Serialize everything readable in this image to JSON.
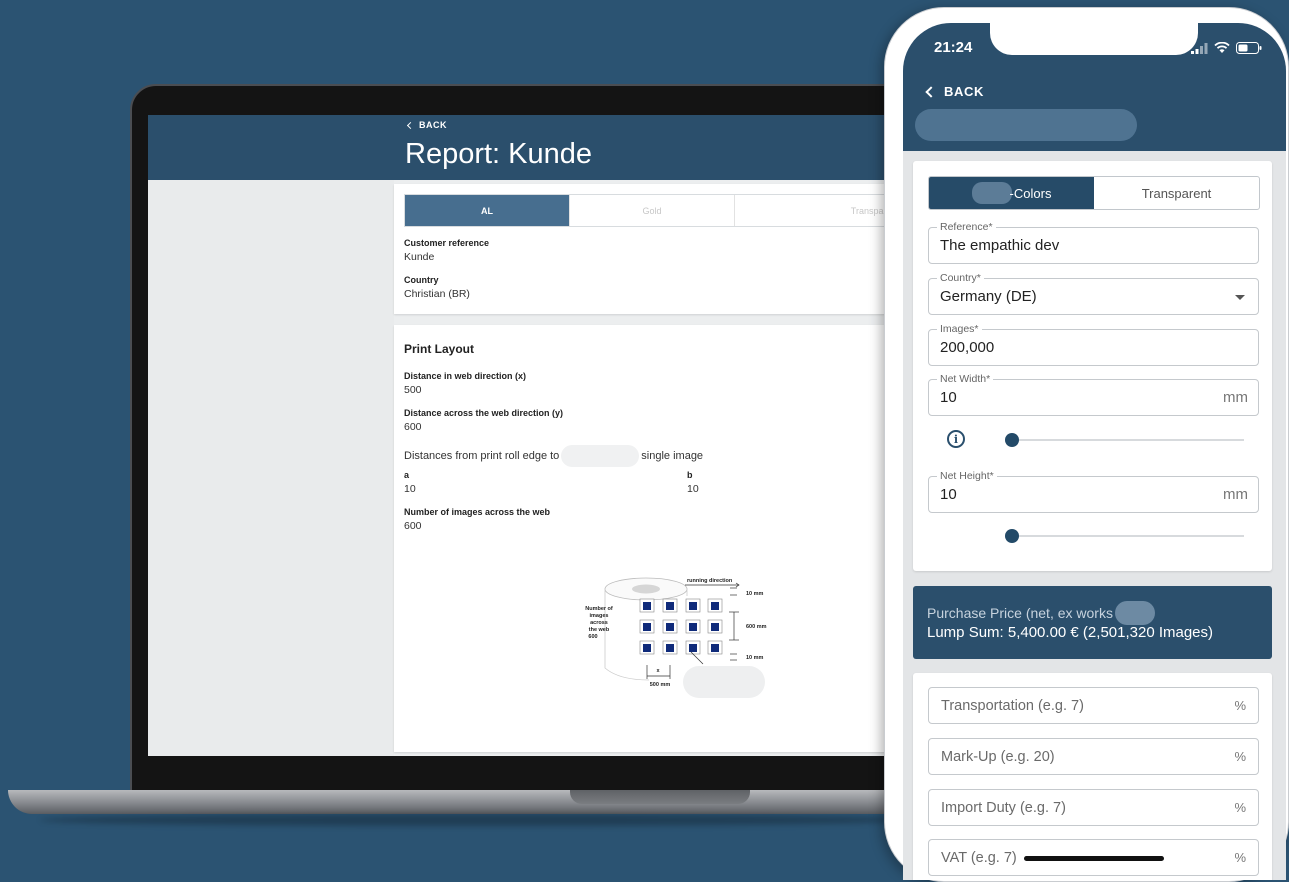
{
  "laptop": {
    "back_label": "BACK",
    "title": "Report: Kunde",
    "tabs": [
      {
        "label": "AL",
        "active": true
      },
      {
        "label": "Gold",
        "active": false
      },
      {
        "label": "Transparent",
        "active": false
      }
    ],
    "customer_reference": {
      "label": "Customer reference",
      "value": "Kunde"
    },
    "country": {
      "label": "Country",
      "value": "Christian (BR)"
    },
    "print_layout": {
      "heading": "Print Layout",
      "distance_x": {
        "label": "Distance in web direction (x)",
        "value": "500"
      },
      "distance_y": {
        "label": "Distance across the web direction (y)",
        "value": "600"
      },
      "distances_text_start": "Distances from print roll edge to",
      "distances_text_end": "single image",
      "a": {
        "label": "a",
        "value": "10"
      },
      "b": {
        "label": "b",
        "value": "10"
      },
      "images_across": {
        "label": "Number of images across the web",
        "value": "600"
      }
    },
    "diagram": {
      "running_direction": "running direction",
      "number_label": [
        "Number of",
        "images",
        "across",
        "the web",
        "600"
      ],
      "dim_top": "10 mm",
      "dim_mid": "600 mm",
      "dim_bottom": "10 mm",
      "x_label": "x",
      "x_value": "500 mm"
    }
  },
  "phone": {
    "time": "21:24",
    "back_label": "BACK",
    "segments": [
      {
        "label": "-Colors",
        "active": true
      },
      {
        "label": "Transparent",
        "active": false
      }
    ],
    "fields": {
      "reference": {
        "label": "Reference*",
        "value": "The empathic dev"
      },
      "country": {
        "label": "Country*",
        "value": "Germany (DE)"
      },
      "images": {
        "label": "Images*",
        "value": "200,000"
      },
      "net_width": {
        "label": "Net Width*",
        "value": "10",
        "unit": "mm"
      },
      "net_height": {
        "label": "Net Height*",
        "value": "10",
        "unit": "mm"
      }
    },
    "purchase_price": {
      "line1": "Purchase Price (net, ex works",
      "line2": "Lump Sum:  5,400.00 €  (2,501,320 Images)"
    },
    "percent_fields": [
      {
        "placeholder": "Transportation (e.g. 7)",
        "unit": "%"
      },
      {
        "placeholder": "Mark-Up (e.g. 20)",
        "unit": "%"
      },
      {
        "placeholder": "Import Duty (e.g. 7)",
        "unit": "%"
      },
      {
        "placeholder": "VAT (e.g. 7)",
        "unit": "%"
      }
    ],
    "colors": {
      "header": "#2b4f6c",
      "accent": "#264b68"
    }
  }
}
